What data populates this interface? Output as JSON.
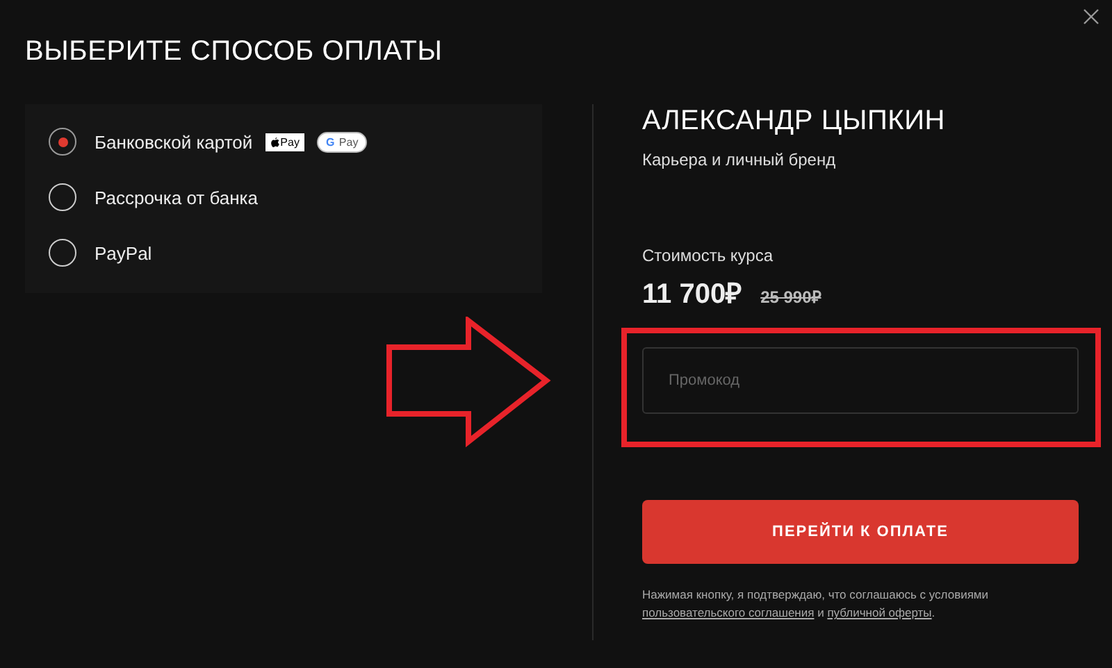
{
  "title": "ВЫБЕРИТЕ СПОСОБ ОПЛАТЫ",
  "methods": [
    {
      "label": "Банковской картой",
      "selected": true,
      "badges": [
        {
          "kind": "apple",
          "label": "Pay"
        },
        {
          "kind": "google",
          "mark": "G",
          "label": "Pay"
        }
      ]
    },
    {
      "label": "Рассрочка от банка",
      "selected": false
    },
    {
      "label": "PayPal",
      "selected": false
    }
  ],
  "course": {
    "author": "АЛЕКСАНДР ЦЫПКИН",
    "name": "Карьера и личный бренд",
    "price_label": "Стоимость курса",
    "price": "11 700₽",
    "old_price": "25 990₽"
  },
  "promo": {
    "placeholder": "Промокод"
  },
  "pay_button": "ПЕРЕЙТИ К ОПЛАТЕ",
  "consent": {
    "before": "Нажимая кнопку, я подтверждаю, что соглашаюсь с условиями",
    "link1": "пользовательского соглашения",
    "middle": " и ",
    "link2": "публичной оферты",
    "after": "."
  },
  "annotations": {
    "arrow": true,
    "frame": true
  }
}
